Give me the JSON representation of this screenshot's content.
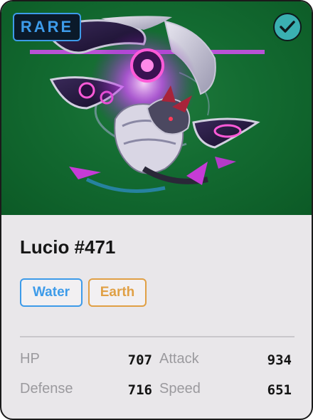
{
  "card": {
    "rarity": "RARE",
    "owned_icon": "check-icon",
    "name": "Lucio #471",
    "types": [
      {
        "label": "Water",
        "color": "#3d9be9"
      },
      {
        "label": "Earth",
        "color": "#e0a045"
      }
    ],
    "stats": [
      {
        "label": "HP",
        "value": "707"
      },
      {
        "label": "Attack",
        "value": "934"
      },
      {
        "label": "Defense",
        "value": "716"
      },
      {
        "label": "Speed",
        "value": "651"
      }
    ]
  },
  "colors": {
    "art_background": "#136b31",
    "rarity_accent": "#3d9be9",
    "check_badge": "#3ab0b2",
    "card_background": "#e9e7ea"
  }
}
